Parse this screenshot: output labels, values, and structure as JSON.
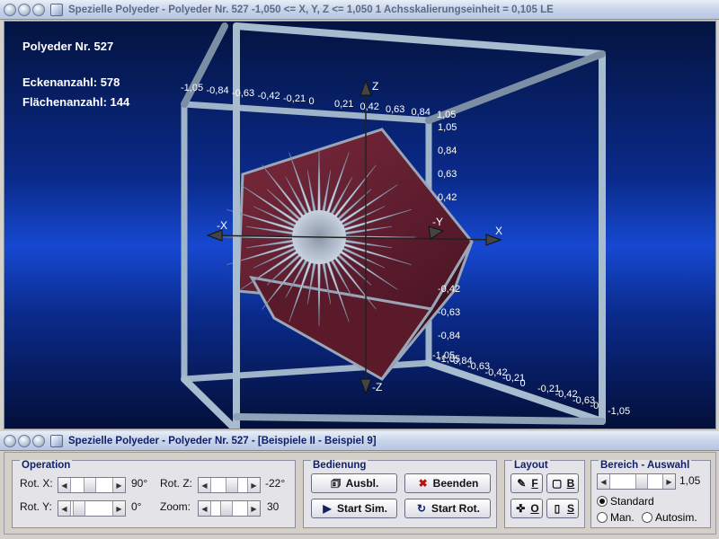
{
  "window": {
    "title": "Spezielle Polyeder - Polyeder Nr. 527   -1,050 <= X, Y, Z <= 1,050    1 Achsskalierungseinheit = 0,105 LE"
  },
  "viewport": {
    "heading": "Polyeder Nr. 527",
    "corners_label": "Eckenanzahl: 578",
    "faces_label": "Flächenanzahl: 144",
    "axis_labels": {
      "x": "X",
      "neg_x": "-X",
      "y": "-Y",
      "z": "Z",
      "neg_z": "-Z"
    },
    "top_ticks": [
      "-1,05",
      "-0,84",
      "-0,63",
      "-0,42",
      "-0,21",
      "0",
      "0,21",
      "0,42",
      "0,63",
      "0,84",
      "1,05"
    ],
    "z_ticks": [
      "1,05",
      "0,84",
      "0,63",
      "0,42"
    ],
    "z_neg_ticks": [
      "-0,42",
      "-0,63",
      "-0,84",
      "-1,05"
    ],
    "bottom_ticks": [
      "-1,05",
      "-0,84",
      "-0,63",
      "-0,42",
      "-0,21",
      "0",
      "-0,21",
      "-0,42",
      "-0,63",
      "-0",
      "-1,05"
    ],
    "colors": {
      "background": "#03123f",
      "band": "#1040c0",
      "frame": "#a8bcd0",
      "cube": "#6a2030",
      "star": "#b8c4d4"
    }
  },
  "panel_window": {
    "title": "Spezielle Polyeder - Polyeder Nr. 527 - [Beispiele II - Beispiel 9]"
  },
  "operation": {
    "title": "Operation",
    "rot_x_label": "Rot. X:",
    "rot_x_value": "90°",
    "rot_y_label": "Rot. Y:",
    "rot_y_value": "0°",
    "rot_z_label": "Rot. Z:",
    "rot_z_value": "-22°",
    "zoom_label": "Zoom:",
    "zoom_value": "30"
  },
  "bedienung": {
    "title": "Bedienung",
    "ausbl_label": "Ausbl.",
    "beenden_label": "Beenden",
    "start_sim_label": "Start Sim.",
    "start_rot_label": "Start Rot."
  },
  "layout": {
    "title": "Layout",
    "f_label": "F",
    "b_label": "B",
    "o_label": "O",
    "s_label": "S"
  },
  "bereich": {
    "title": "Bereich - Auswahl",
    "range_value": "1,05",
    "standard_label": "Standard",
    "man_label": "Man.",
    "autosim_label": "Autosim.",
    "selected": "Standard"
  }
}
